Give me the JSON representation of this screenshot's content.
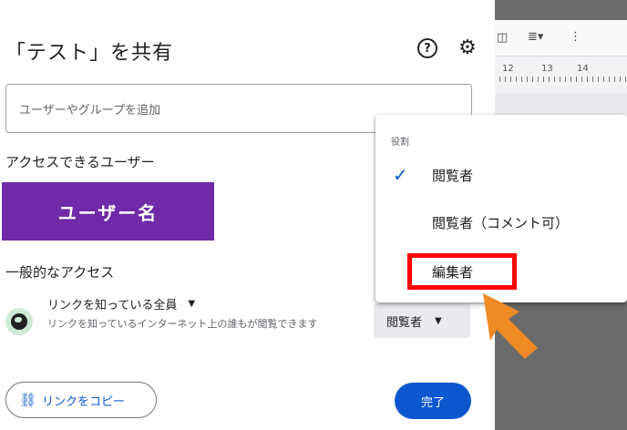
{
  "dialog": {
    "title": "「テスト」を共有",
    "help_icon": "help-circle-icon",
    "settings_icon": "gear-icon",
    "add_people_placeholder": "ユーザーやグループを追加",
    "people_with_access_label": "アクセスできるユーザー",
    "user_name": "ユーザー名",
    "user_chip_color": "#6f2aa8",
    "general_access_label": "一般的なアクセス",
    "link_scope": "リンクを知っている全員",
    "link_description": "リンクを知っているインターネット上の誰もが閲覧できます",
    "current_role": "閲覧者",
    "copy_link_label": "リンクをコピー",
    "done_label": "完了",
    "accent_color": "#0b57d0"
  },
  "role_menu": {
    "header": "役割",
    "items": [
      {
        "label": "閲覧者",
        "selected": true
      },
      {
        "label": "閲覧者（コメント可）",
        "selected": false
      },
      {
        "label": "編集者",
        "selected": false,
        "highlighted": true
      }
    ]
  },
  "annotation": {
    "highlight_color": "#ff0000",
    "arrow_color": "#f08a24"
  },
  "doc_background": {
    "ruler_numbers": [
      "12",
      "13",
      "14"
    ]
  }
}
